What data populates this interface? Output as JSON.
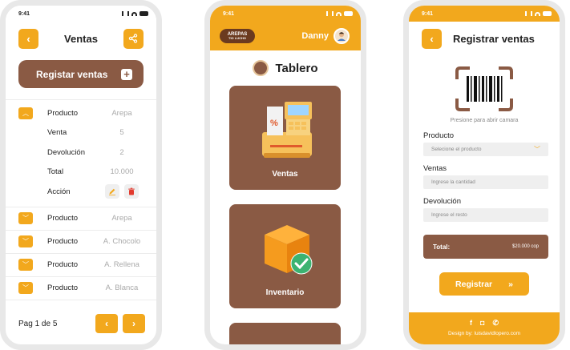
{
  "status_time": "9:41",
  "ventas": {
    "back_glyph": "‹",
    "title": "Ventas",
    "share_glyph": "⋖",
    "register_button": "Registar ventas",
    "plus_glyph": "+",
    "expanded": {
      "rows": [
        {
          "label": "Producto",
          "value": "Arepa"
        },
        {
          "label": "Venta",
          "value": "5"
        },
        {
          "label": "Devolución",
          "value": "2"
        },
        {
          "label": "Total",
          "value": "10.000"
        }
      ],
      "action_label": "Acción"
    },
    "items": [
      {
        "label": "Producto",
        "value": "Arepa"
      },
      {
        "label": "Producto",
        "value": "A. Chocolo"
      },
      {
        "label": "Producto",
        "value": "A. Rellena"
      },
      {
        "label": "Producto",
        "value": "A. Blanca"
      }
    ],
    "pagination": "Pag 1 de 5",
    "prev_glyph": "‹",
    "next_glyph": "›"
  },
  "dashboard": {
    "logo_line1": "AREPAS",
    "logo_line2": "TIO LUCHO",
    "user_name": "Danny",
    "title": "Tablero",
    "cards": [
      {
        "label": "Ventas"
      },
      {
        "label": "Inventario"
      }
    ]
  },
  "registro": {
    "back_glyph": "‹",
    "title": "Registrar ventas",
    "scan_hint": "Presione para abrir camara",
    "producto_label": "Producto",
    "producto_placeholder": "Selecione el producto",
    "ventas_label": "Ventas",
    "ventas_placeholder": "Ingrese la cantidad",
    "devolucion_label": "Devolución",
    "devolucion_placeholder": "Ingrese el resto",
    "total_label": "Total:",
    "total_value": "$20.000 cop",
    "submit_label": "Registrar",
    "footer_credit": "Design by: luisdavidlopero.com"
  },
  "colors": {
    "accent": "#f2a81d",
    "brown": "#8a5a44"
  }
}
